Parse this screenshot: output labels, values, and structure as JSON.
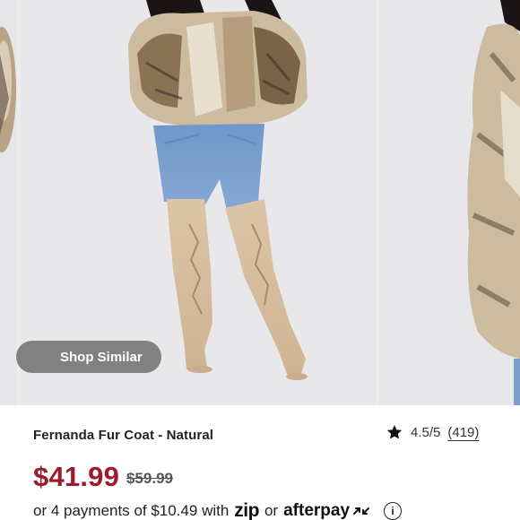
{
  "gallery": {
    "shop_similar_label": "Shop Similar"
  },
  "product": {
    "title": "Fernanda Fur Coat - Natural",
    "rating": "4.5/5",
    "review_count": "(419)",
    "price": "$41.99",
    "original_price": "$59.99"
  },
  "payments": {
    "prefix": "or 4 payments of $10.49 with",
    "zip_logo": "zip",
    "separator": "or",
    "afterpay_logo": "afterpay"
  },
  "colors": {
    "price": "#9b1c2e",
    "shop_similar_bg": "#6e6e6e",
    "background": "#ffffff"
  },
  "icons": [
    "star-icon",
    "info-icon",
    "afterpay-logo-icon",
    "zip-logo-icon"
  ]
}
